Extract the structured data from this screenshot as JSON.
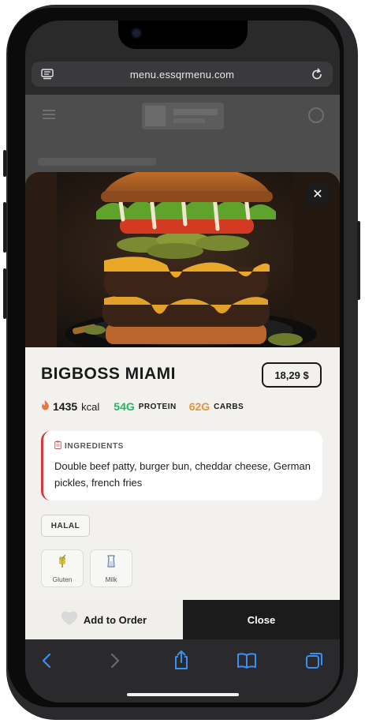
{
  "browser": {
    "url": "menu.essqrmenu.com",
    "icons": {
      "tabs_left": "reader-icon",
      "reload": "reload-icon"
    }
  },
  "product": {
    "title": "BIGBOSS MIAMI",
    "price": "18,29 $",
    "calories_value": "1435",
    "calories_unit": "kcal",
    "protein_value": "54G",
    "protein_label": "PROTEIN",
    "carbs_value": "62G",
    "carbs_label": "CARBS",
    "ingredients_heading": "INGREDIENTS",
    "ingredients_text": "Double beef patty, burger bun, cheddar cheese, German pickles, french fries",
    "tags": [
      "HALAL"
    ],
    "allergens": [
      {
        "label": "Gluten",
        "icon": "wheat-icon"
      },
      {
        "label": "Milk",
        "icon": "milk-icon"
      }
    ]
  },
  "actions": {
    "add_label": "Add to Order",
    "close_label": "Close"
  },
  "colors": {
    "protein": "#1fba5e",
    "carbs": "#e8913b",
    "ingredients_accent": "#d23b3b",
    "dark": "#1b1b1b"
  }
}
